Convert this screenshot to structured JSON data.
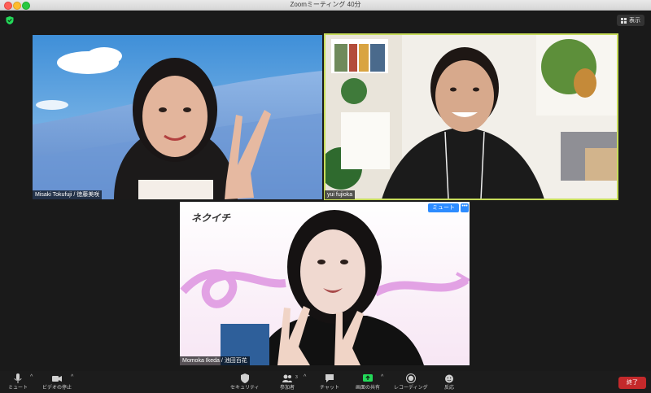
{
  "window": {
    "title": "Zoomミーティング 40分"
  },
  "top_controls": {
    "view_label": "表示"
  },
  "participants": [
    {
      "name": "Misaki Tokufuji / 徳藤美咲"
    },
    {
      "name": "yui fujioka"
    },
    {
      "name": "Momoka Ikeda / 池田百花",
      "mute_label": "ミュート",
      "more_label": "•••"
    }
  ],
  "toolbar": {
    "mute": "ミュート",
    "video": "ビデオの停止",
    "security": "セキュリティ",
    "participants": "参加者",
    "participants_count": "3",
    "chat": "チャット",
    "share": "画面の共有",
    "record": "レコーディング",
    "reactions": "反応",
    "end": "終了"
  },
  "colors": {
    "active_speaker": "#c6db5a",
    "share_green": "#23d959",
    "end_red": "#c4292b",
    "mute_blue": "#2d8cff"
  }
}
